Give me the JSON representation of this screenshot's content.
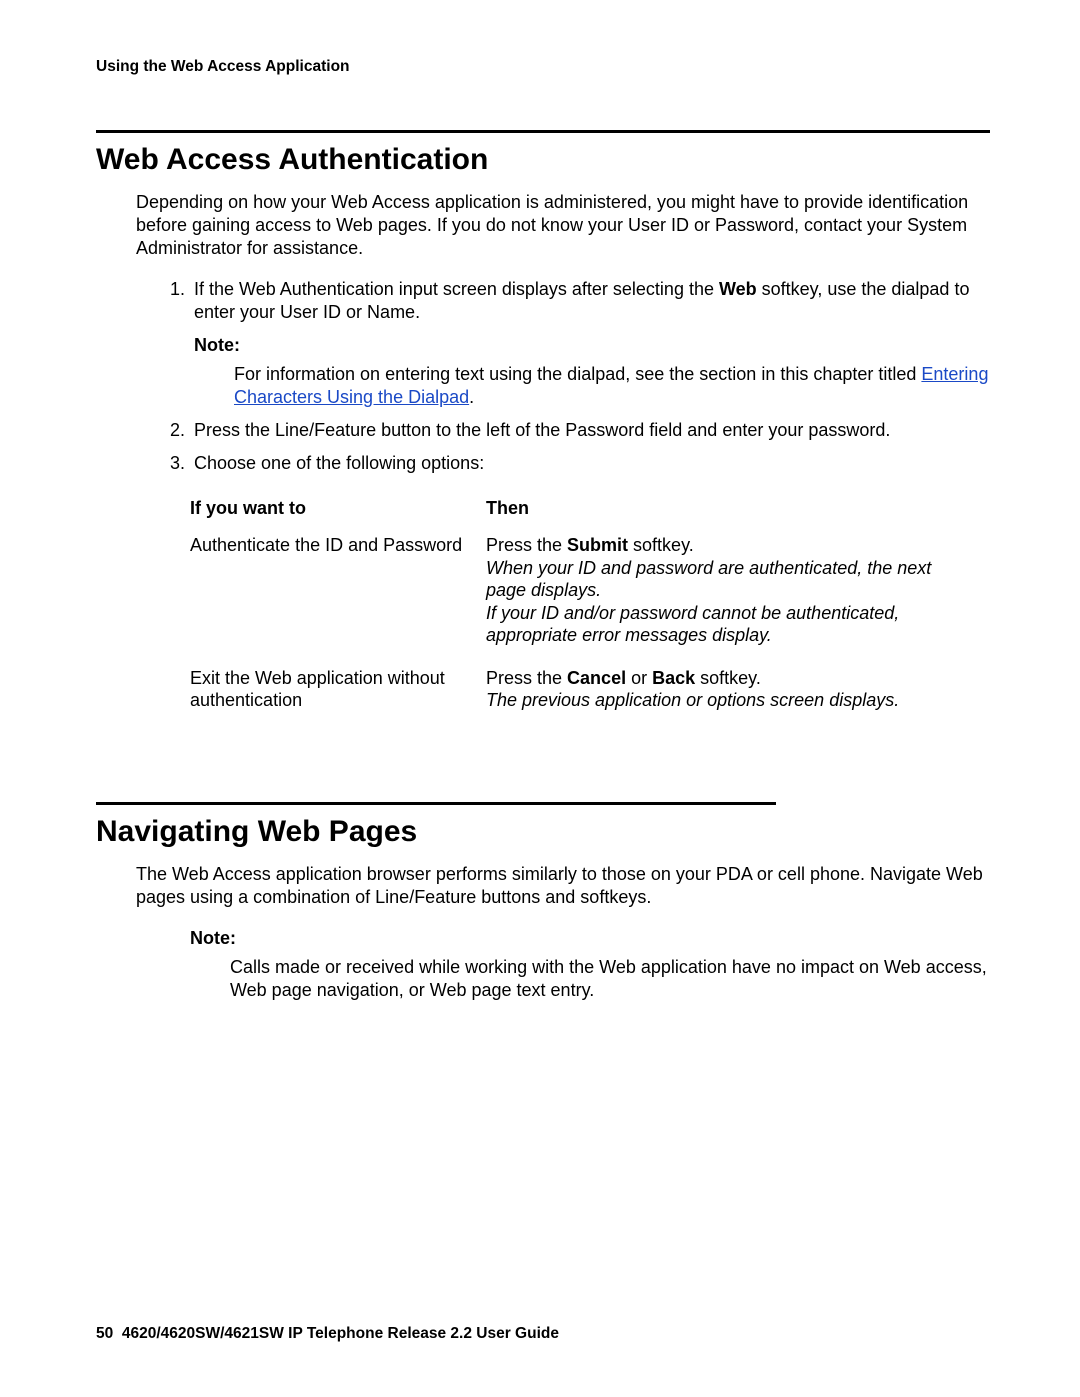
{
  "runningHead": "Using the Web Access Application",
  "section1": {
    "title": "Web Access Authentication",
    "intro": "Depending on how your Web Access application is administered, you might have to provide identification before gaining access to Web pages. If you do not know your User ID or Password, contact your System Administrator for assistance.",
    "step1_a": "If the Web Authentication input screen displays after selecting the ",
    "step1_bold": "Web",
    "step1_b": " softkey, use the dialpad to enter your User ID or Name.",
    "noteLabel": "Note:",
    "noteBody_a": "For information on entering text using the dialpad, see the section in this chapter titled ",
    "noteLink": "Entering Characters Using the Dialpad",
    "noteBody_b": ".",
    "step2": "Press the Line/Feature button to the left of the Password field and enter your password.",
    "step3": "Choose one of the following options:"
  },
  "table": {
    "h1": "If you want to",
    "h2": "Then",
    "r1c1": "Authenticate the ID and Password",
    "r1c2_a": "Press the ",
    "r1c2_bold": "Submit",
    "r1c2_b": " softkey.",
    "r1c2_it1": "When your ID and password are authenticated, the next page displays.",
    "r1c2_it2": "If your ID and/or password cannot be authenticated, appropriate error messages display.",
    "r2c1": "Exit the Web application without authentication",
    "r2c2_a": "Press the ",
    "r2c2_bold1": "Cancel",
    "r2c2_mid": " or ",
    "r2c2_bold2": "Back",
    "r2c2_b": " softkey.",
    "r2c2_it": "The previous application or options screen displays."
  },
  "section2": {
    "title": "Navigating Web Pages",
    "intro": "The Web Access application browser performs similarly to those on your PDA or cell phone. Navigate Web pages using a combination of Line/Feature buttons and softkeys.",
    "noteLabel": "Note:",
    "noteBody": "Calls made or received while working with the Web application have no impact on Web access, Web page navigation, or Web page text entry."
  },
  "footer": {
    "pageNum": "50",
    "text": "4620/4620SW/4621SW IP Telephone Release 2.2 User Guide"
  }
}
